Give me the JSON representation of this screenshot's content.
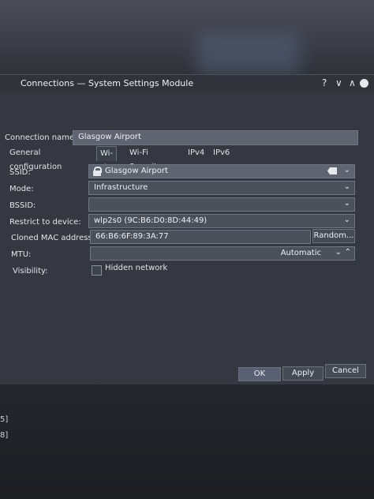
{
  "window": {
    "title": "Connections — System Settings Module",
    "help_glyph": "?",
    "minimize_glyph": "∨",
    "maximize_glyph": "∧"
  },
  "connection": {
    "name_label": "Connection name:",
    "name_value": "Glasgow Airport"
  },
  "tabs": [
    {
      "label": "General configuration"
    },
    {
      "label": "Wi-Fi"
    },
    {
      "label": "Wi-Fi Security"
    },
    {
      "label": "IPv4"
    },
    {
      "label": "IPv6"
    }
  ],
  "wifi": {
    "ssid_label": "SSID:",
    "ssid_value": "Glasgow Airport",
    "mode_label": "Mode:",
    "mode_value": "Infrastructure",
    "bssid_label": "BSSID:",
    "bssid_value": "",
    "restrict_label": "Restrict to device:",
    "restrict_value": "wlp2s0 (9C:B6:D0:8D:44:49)",
    "cloned_label": "Cloned MAC address:",
    "cloned_value": "66:B6:6F:89:3A:77",
    "random_button": "Random...",
    "mtu_label": "MTU:",
    "mtu_value": "Automatic",
    "visibility_label": "Visibility:",
    "hidden_label": "Hidden network"
  },
  "buttons": {
    "ok": "OK",
    "apply": "Apply",
    "cancel": "Cancel"
  },
  "left_fragments": [
    "5]",
    "8]"
  ]
}
